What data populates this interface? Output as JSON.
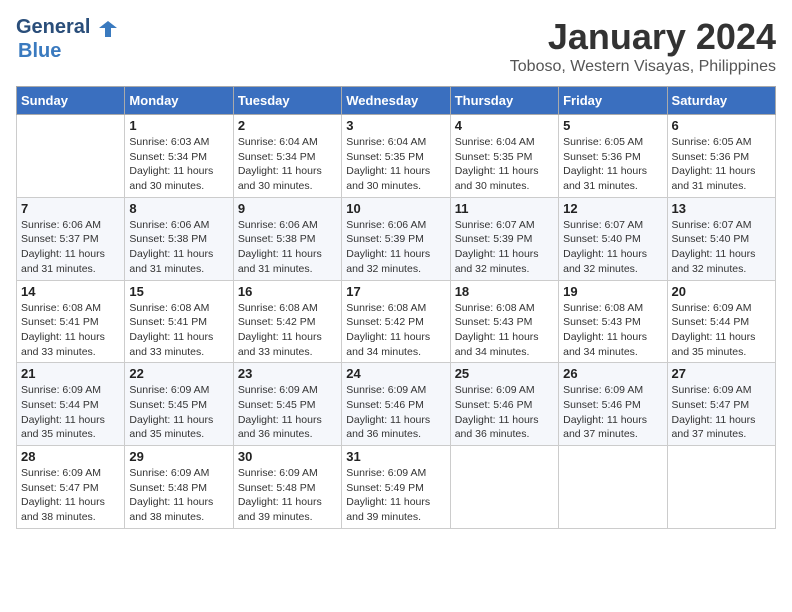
{
  "header": {
    "logo_line1": "General",
    "logo_line2": "Blue",
    "month_title": "January 2024",
    "location": "Toboso, Western Visayas, Philippines"
  },
  "weekdays": [
    "Sunday",
    "Monday",
    "Tuesday",
    "Wednesday",
    "Thursday",
    "Friday",
    "Saturday"
  ],
  "weeks": [
    [
      {
        "day": "",
        "info": ""
      },
      {
        "day": "1",
        "info": "Sunrise: 6:03 AM\nSunset: 5:34 PM\nDaylight: 11 hours\nand 30 minutes."
      },
      {
        "day": "2",
        "info": "Sunrise: 6:04 AM\nSunset: 5:34 PM\nDaylight: 11 hours\nand 30 minutes."
      },
      {
        "day": "3",
        "info": "Sunrise: 6:04 AM\nSunset: 5:35 PM\nDaylight: 11 hours\nand 30 minutes."
      },
      {
        "day": "4",
        "info": "Sunrise: 6:04 AM\nSunset: 5:35 PM\nDaylight: 11 hours\nand 30 minutes."
      },
      {
        "day": "5",
        "info": "Sunrise: 6:05 AM\nSunset: 5:36 PM\nDaylight: 11 hours\nand 31 minutes."
      },
      {
        "day": "6",
        "info": "Sunrise: 6:05 AM\nSunset: 5:36 PM\nDaylight: 11 hours\nand 31 minutes."
      }
    ],
    [
      {
        "day": "7",
        "info": "Sunrise: 6:06 AM\nSunset: 5:37 PM\nDaylight: 11 hours\nand 31 minutes."
      },
      {
        "day": "8",
        "info": "Sunrise: 6:06 AM\nSunset: 5:38 PM\nDaylight: 11 hours\nand 31 minutes."
      },
      {
        "day": "9",
        "info": "Sunrise: 6:06 AM\nSunset: 5:38 PM\nDaylight: 11 hours\nand 31 minutes."
      },
      {
        "day": "10",
        "info": "Sunrise: 6:06 AM\nSunset: 5:39 PM\nDaylight: 11 hours\nand 32 minutes."
      },
      {
        "day": "11",
        "info": "Sunrise: 6:07 AM\nSunset: 5:39 PM\nDaylight: 11 hours\nand 32 minutes."
      },
      {
        "day": "12",
        "info": "Sunrise: 6:07 AM\nSunset: 5:40 PM\nDaylight: 11 hours\nand 32 minutes."
      },
      {
        "day": "13",
        "info": "Sunrise: 6:07 AM\nSunset: 5:40 PM\nDaylight: 11 hours\nand 32 minutes."
      }
    ],
    [
      {
        "day": "14",
        "info": "Sunrise: 6:08 AM\nSunset: 5:41 PM\nDaylight: 11 hours\nand 33 minutes."
      },
      {
        "day": "15",
        "info": "Sunrise: 6:08 AM\nSunset: 5:41 PM\nDaylight: 11 hours\nand 33 minutes."
      },
      {
        "day": "16",
        "info": "Sunrise: 6:08 AM\nSunset: 5:42 PM\nDaylight: 11 hours\nand 33 minutes."
      },
      {
        "day": "17",
        "info": "Sunrise: 6:08 AM\nSunset: 5:42 PM\nDaylight: 11 hours\nand 34 minutes."
      },
      {
        "day": "18",
        "info": "Sunrise: 6:08 AM\nSunset: 5:43 PM\nDaylight: 11 hours\nand 34 minutes."
      },
      {
        "day": "19",
        "info": "Sunrise: 6:08 AM\nSunset: 5:43 PM\nDaylight: 11 hours\nand 34 minutes."
      },
      {
        "day": "20",
        "info": "Sunrise: 6:09 AM\nSunset: 5:44 PM\nDaylight: 11 hours\nand 35 minutes."
      }
    ],
    [
      {
        "day": "21",
        "info": "Sunrise: 6:09 AM\nSunset: 5:44 PM\nDaylight: 11 hours\nand 35 minutes."
      },
      {
        "day": "22",
        "info": "Sunrise: 6:09 AM\nSunset: 5:45 PM\nDaylight: 11 hours\nand 35 minutes."
      },
      {
        "day": "23",
        "info": "Sunrise: 6:09 AM\nSunset: 5:45 PM\nDaylight: 11 hours\nand 36 minutes."
      },
      {
        "day": "24",
        "info": "Sunrise: 6:09 AM\nSunset: 5:46 PM\nDaylight: 11 hours\nand 36 minutes."
      },
      {
        "day": "25",
        "info": "Sunrise: 6:09 AM\nSunset: 5:46 PM\nDaylight: 11 hours\nand 36 minutes."
      },
      {
        "day": "26",
        "info": "Sunrise: 6:09 AM\nSunset: 5:46 PM\nDaylight: 11 hours\nand 37 minutes."
      },
      {
        "day": "27",
        "info": "Sunrise: 6:09 AM\nSunset: 5:47 PM\nDaylight: 11 hours\nand 37 minutes."
      }
    ],
    [
      {
        "day": "28",
        "info": "Sunrise: 6:09 AM\nSunset: 5:47 PM\nDaylight: 11 hours\nand 38 minutes."
      },
      {
        "day": "29",
        "info": "Sunrise: 6:09 AM\nSunset: 5:48 PM\nDaylight: 11 hours\nand 38 minutes."
      },
      {
        "day": "30",
        "info": "Sunrise: 6:09 AM\nSunset: 5:48 PM\nDaylight: 11 hours\nand 39 minutes."
      },
      {
        "day": "31",
        "info": "Sunrise: 6:09 AM\nSunset: 5:49 PM\nDaylight: 11 hours\nand 39 minutes."
      },
      {
        "day": "",
        "info": ""
      },
      {
        "day": "",
        "info": ""
      },
      {
        "day": "",
        "info": ""
      }
    ]
  ]
}
